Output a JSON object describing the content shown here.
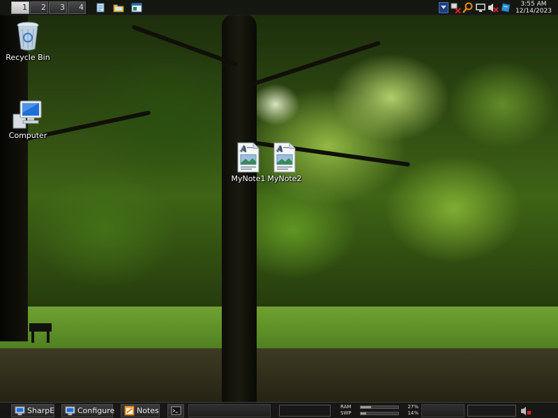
{
  "desktop": {
    "icons": [
      {
        "label": "Recycle Bin",
        "icon": "recycle-bin-icon"
      },
      {
        "label": "Computer",
        "icon": "computer-icon"
      },
      {
        "label": "MyNote1",
        "icon": "document-icon"
      },
      {
        "label": "MyNote2",
        "icon": "document-icon"
      }
    ]
  },
  "top_bar": {
    "workspaces": [
      "1",
      "2",
      "3",
      "4"
    ],
    "active_workspace": "1",
    "quick_launch": [
      "notepad-icon",
      "folder-icon",
      "window-icon"
    ],
    "tray_icons": [
      "network-disconnected-icon",
      "search-icon",
      "display-icon",
      "volume-muted-icon",
      "app-icon"
    ],
    "clock": {
      "time": "3:55 AM",
      "date": "12/14/2023"
    }
  },
  "bottom_bar": {
    "tasks": [
      {
        "label": "SharpE",
        "icon": "computer-icon"
      },
      {
        "label": "Configure",
        "icon": "computer-icon"
      },
      {
        "label": "Notes",
        "icon": "notes-icon"
      },
      {
        "label": "",
        "icon": "terminal-icon"
      }
    ],
    "memory": {
      "ram_label": "RAM",
      "ram_percent": "27%",
      "ram_value": 27,
      "swp_label": "SWP",
      "swp_percent": "14%",
      "swp_value": 14
    }
  },
  "colors": {
    "accent": "#1e3f7a",
    "bar": "#161616"
  }
}
